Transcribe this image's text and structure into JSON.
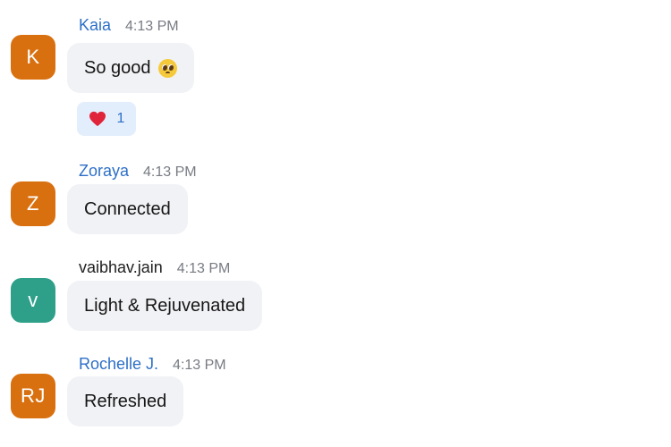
{
  "messages": [
    {
      "sender": "Kaia",
      "time": "4:13 PM",
      "avatar_initials": "K",
      "avatar_color": "#d9700f",
      "text": "So good",
      "text_emoji": "pleading-face-icon",
      "reaction": {
        "icon": "heart-icon",
        "count": "1"
      }
    },
    {
      "sender": "Zoraya",
      "time": "4:13 PM",
      "avatar_initials": "Z",
      "avatar_color": "#d9700f",
      "text": "Connected"
    },
    {
      "sender": "vaibhav.jain",
      "time": "4:13 PM",
      "avatar_initials": "v",
      "avatar_color": "#2ea08a",
      "text": "Light & Rejuvenated"
    },
    {
      "sender": "Rochelle J.",
      "time": "4:13 PM",
      "avatar_initials": "RJ",
      "avatar_color": "#d9700f",
      "text": "Refreshed"
    }
  ],
  "colors": {
    "sender_name_blue": "#2d6fc7",
    "bubble_bg": "#f1f2f5",
    "reaction_bg": "#e3eefc"
  }
}
